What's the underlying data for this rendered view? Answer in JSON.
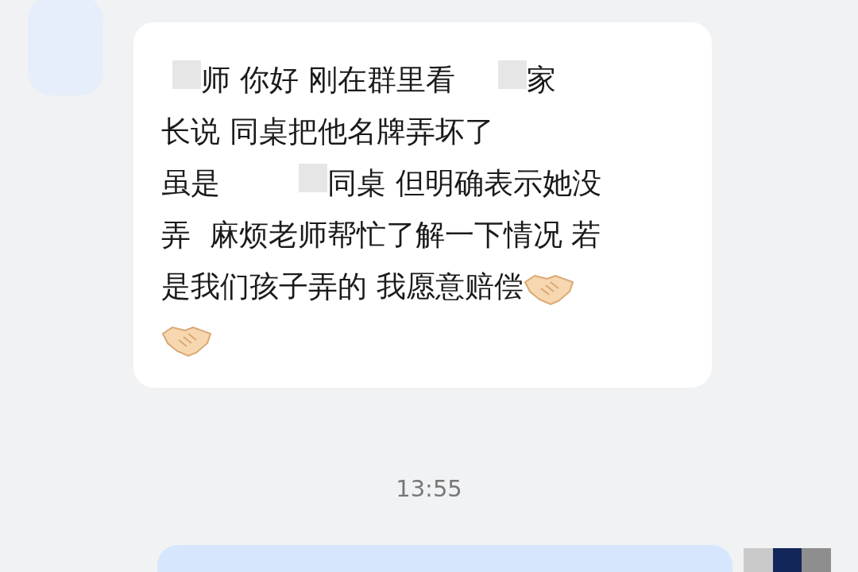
{
  "incoming": {
    "lines": [
      [
        {
          "kind": "gap-short"
        },
        {
          "kind": "text",
          "text": "师 你好 刚在群里看"
        },
        {
          "kind": "gap-medium"
        },
        {
          "kind": "text",
          "text": "家"
        }
      ],
      [
        {
          "kind": "text",
          "text": "长说 同桌把他名牌弄坏了"
        }
      ],
      [
        {
          "kind": "text",
          "text": "虽是"
        },
        {
          "kind": "gap-long"
        },
        {
          "kind": "text",
          "text": "同桌 但明确表示她没"
        }
      ],
      [
        {
          "kind": "text",
          "text": "弄  麻烦老师帮忙了解一下情况 若"
        }
      ],
      [
        {
          "kind": "text",
          "text": "是我们孩子弄的 我愿意赔偿"
        },
        {
          "kind": "handshake"
        }
      ],
      [
        {
          "kind": "handshake"
        }
      ]
    ]
  },
  "timestamp": "13:55",
  "outgoing": {
    "kind": "cut-off"
  }
}
